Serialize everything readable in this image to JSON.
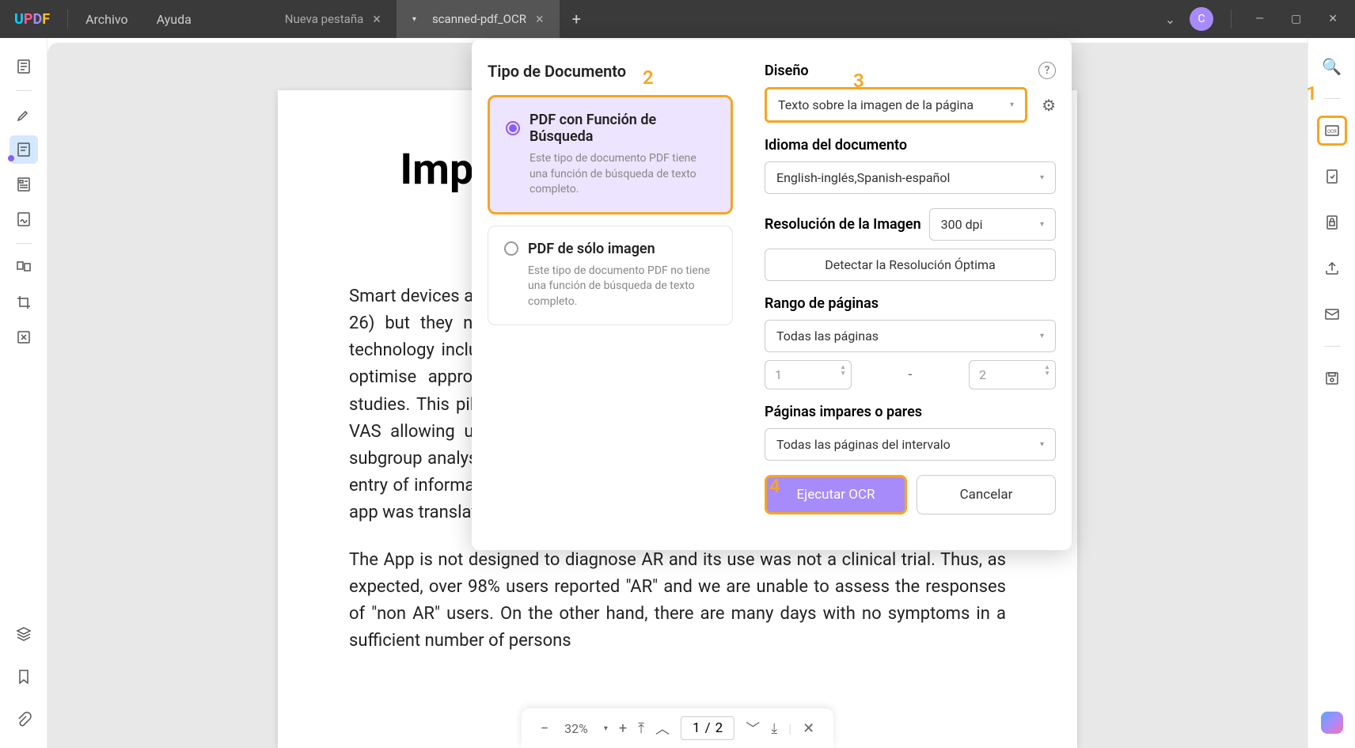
{
  "titlebar": {
    "logo": {
      "u": "U",
      "p": "P",
      "d": "D",
      "f": "F"
    },
    "menu_archivo": "Archivo",
    "menu_ayuda": "Ayuda",
    "tab1_label": "Nueva pestaña",
    "tab2_label": "scanned-pdf_OCR",
    "avatar_letter": "C"
  },
  "document": {
    "heading": "Improve Work Productivity in Rhinitis",
    "para1": "Smart devices and internet-based applications (Apps) are already used in rhinitis (24-26) but they never assessed work productivity. The strengths of using mobile technology include its widespread availability and easy use, but there is a need to optimise appropriate questions and result interpretation as assessed by pilot studies. This pilot study is only based on 1,136 users who filled in a total of 5,528 VAS allowing us to perform comparisons of global outcomes, but not to make subgroup analyses (iPA). We collected country, language, age and sex at the date of entry of information with the app and we used very simple questions translated. The app was translated into 15 languages.",
    "para2": "The App is not designed to diagnose AR and its use was not a clinical trial. Thus, as expected, over 98% users reported \"AR\" and we are unable to assess the responses of \"non AR\" users. On the other hand, there are many days with no symptoms in a sufficient number of persons"
  },
  "bottom_nav": {
    "zoom": "32%",
    "page_current": "1",
    "page_sep": "/",
    "page_total": "2"
  },
  "ocr": {
    "left_title": "Tipo de Documento",
    "opt1_title": "PDF con Función de Búsqueda",
    "opt1_desc": "Este tipo de documento PDF tiene una función de búsqueda de texto completo.",
    "opt2_title": "PDF de sólo imagen",
    "opt2_desc": "Este tipo de documento PDF no tiene una función de búsqueda de texto completo.",
    "design_label": "Diseño",
    "design_value": "Texto sobre la imagen de la página",
    "lang_label": "Idioma del documento",
    "lang_value": "English-inglés,Spanish-español",
    "res_label": "Resolución de la Imagen",
    "res_value": "300 dpi",
    "detect_btn": "Detectar la Resolución Óptima",
    "range_label": "Rango de páginas",
    "range_value": "Todas las páginas",
    "range_from": "1",
    "range_to": "2",
    "range_dash": "-",
    "odd_even_label": "Páginas impares o pares",
    "odd_even_value": "Todas las páginas del intervalo",
    "exec_btn": "Ejecutar OCR",
    "cancel_btn": "Cancelar"
  },
  "annotations": {
    "n1": "1",
    "n2": "2",
    "n3": "3",
    "n4": "4"
  }
}
